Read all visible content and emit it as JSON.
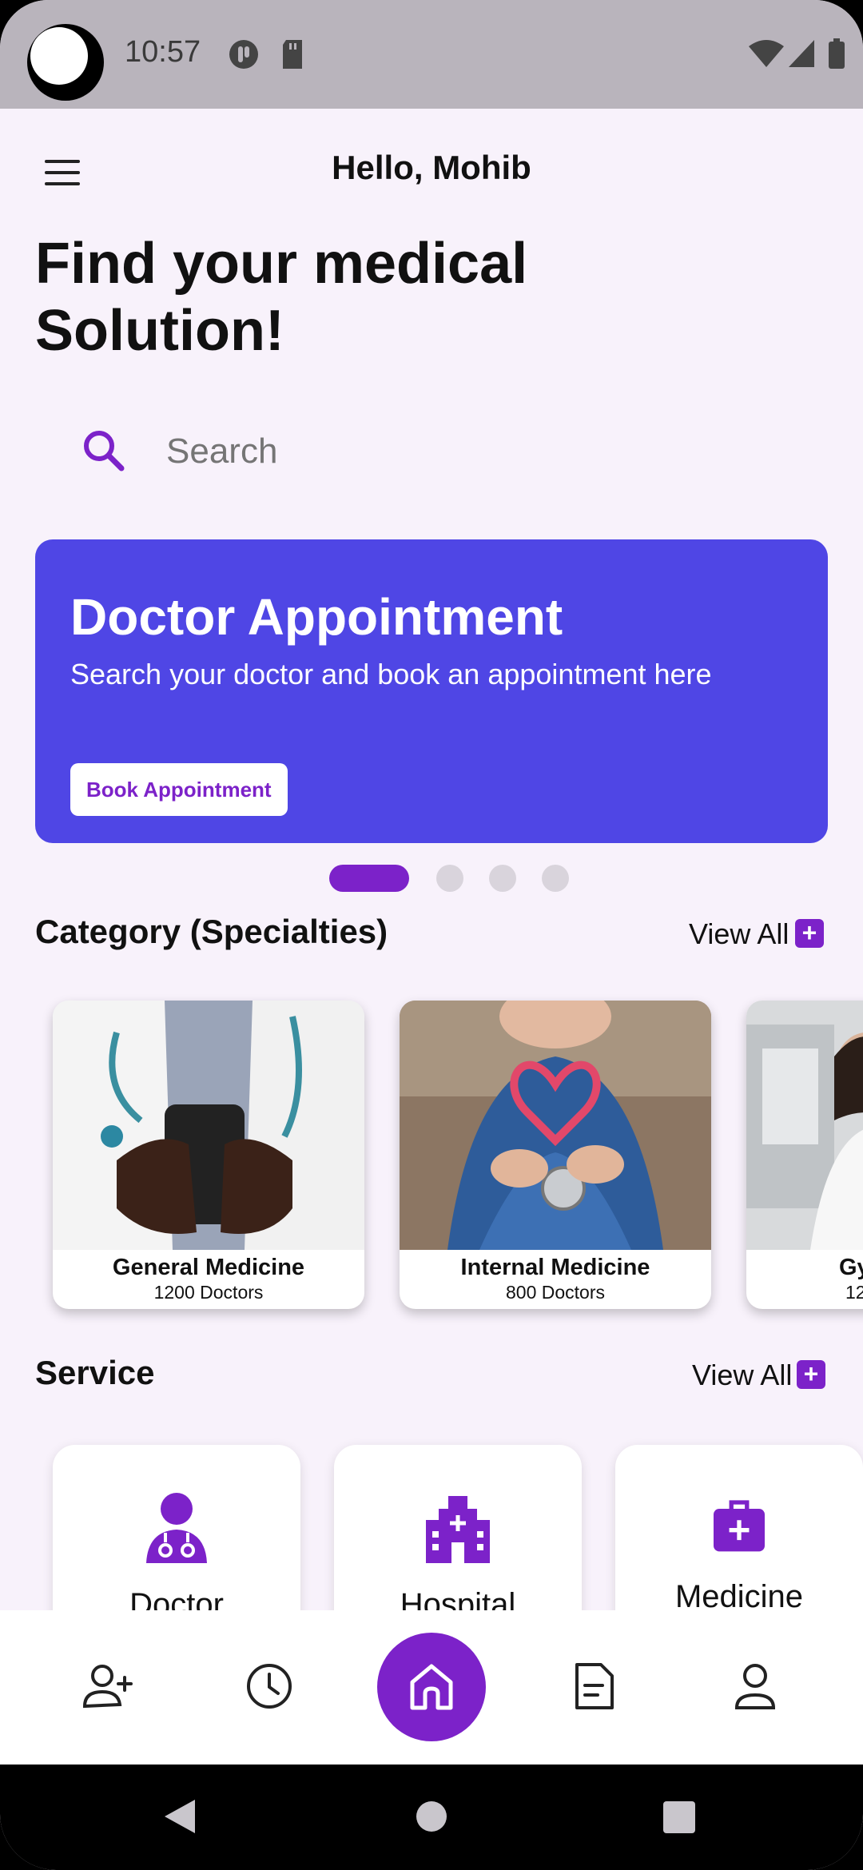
{
  "status_bar": {
    "time": "10:57"
  },
  "header": {
    "greeting": "Hello, Mohib"
  },
  "headline": {
    "line1": "Find your medical",
    "line2": "Solution!"
  },
  "search": {
    "placeholder": "Search"
  },
  "banner": {
    "title": "Doctor Appointment",
    "subtitle": "Search your doctor and book an appointment here",
    "button_label": "Book Appointment",
    "active_slide": 1,
    "total_slides": 4
  },
  "category_section": {
    "title": "Category (Specialties)",
    "view_all": "View All",
    "items": [
      {
        "name": "General Medicine",
        "count": "1200 Doctors"
      },
      {
        "name": "Internal Medicine",
        "count": "800 Doctors"
      },
      {
        "name": "Gy",
        "count": "12"
      }
    ]
  },
  "service_section": {
    "title": "Service",
    "view_all": "View All",
    "items": [
      {
        "label": "Doctor",
        "icon": "doctor-icon"
      },
      {
        "label": "Hospital",
        "icon": "hospital-icon"
      },
      {
        "label": "Medicine",
        "icon": "medicine-icon"
      }
    ]
  },
  "bottom_nav": {
    "items": [
      "add-user-icon",
      "clock-icon",
      "home-icon",
      "document-icon",
      "profile-icon"
    ],
    "active": "home-icon"
  },
  "colors": {
    "accent": "#7C22C9",
    "banner": "#4F46E5",
    "background": "#F8F2FB"
  }
}
